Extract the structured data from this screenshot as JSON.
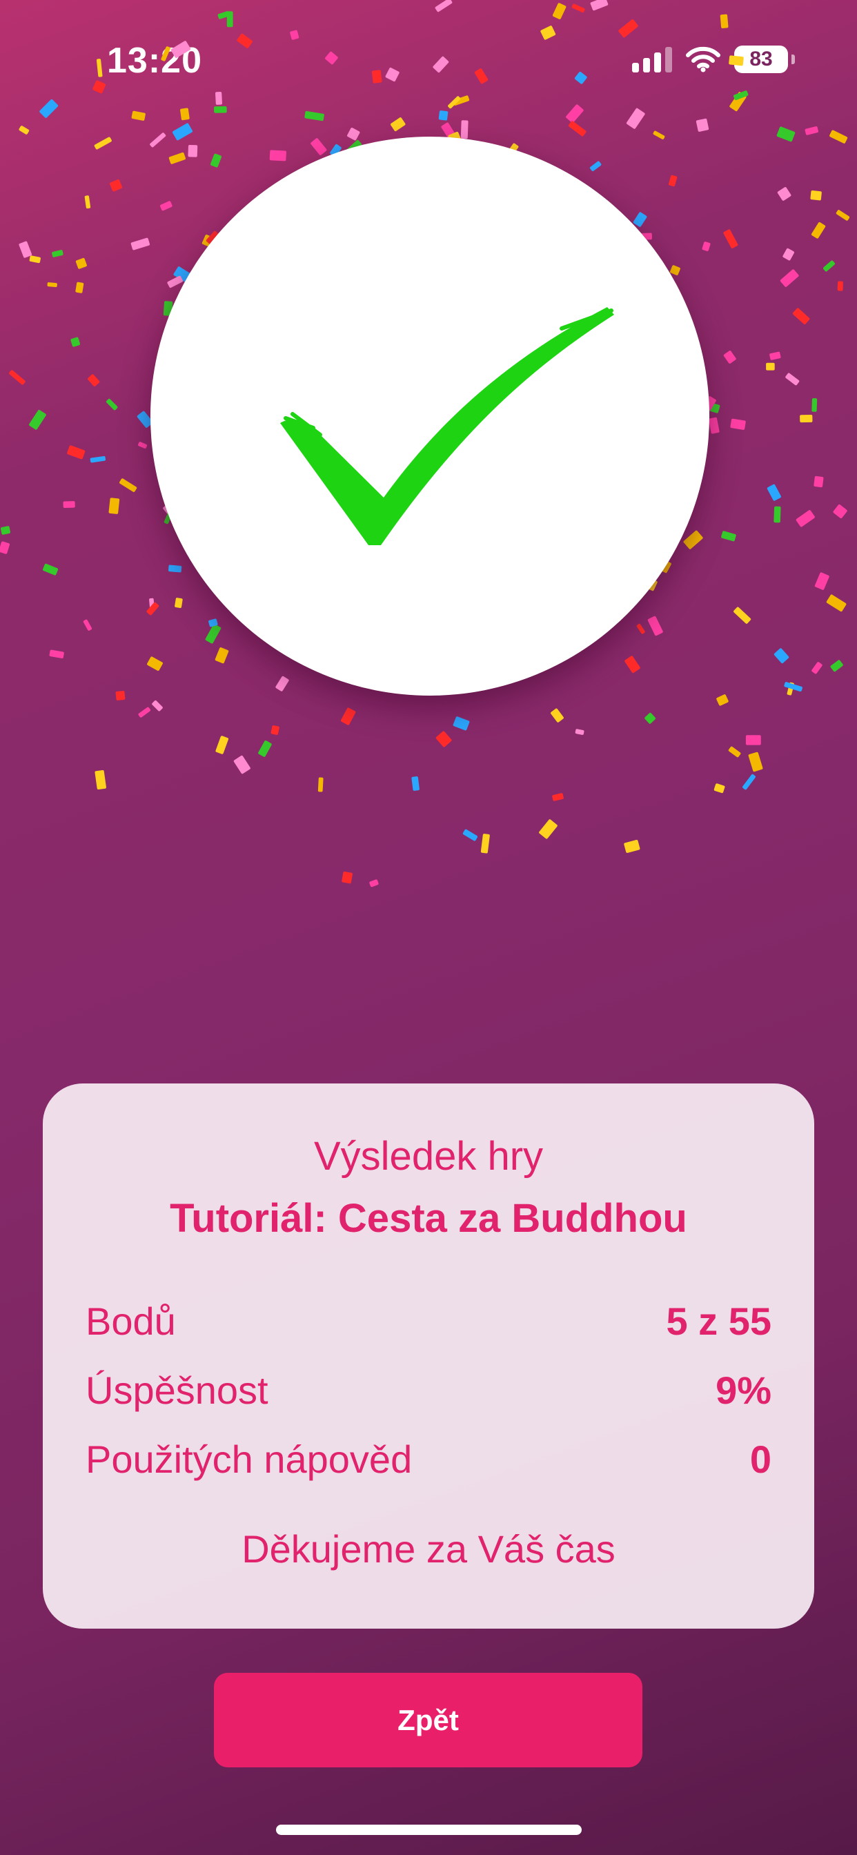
{
  "status_bar": {
    "time": "13:20",
    "battery": "83",
    "icons": [
      "cellular-signal-icon",
      "wifi-icon",
      "battery-icon"
    ]
  },
  "hero": {
    "icon": "check-mark-icon",
    "check_color": "#1ed312",
    "circle_color": "#ffffff"
  },
  "result_card": {
    "heading": "Výsledek hry",
    "title": "Tutoriál: Cesta za Buddhou",
    "stats": [
      {
        "label": "Bodů",
        "value": "5 z 55"
      },
      {
        "label": "Úspěšnost",
        "value": "9%"
      },
      {
        "label": "Použitých nápověd",
        "value": "0"
      }
    ],
    "thanks": "Děkujeme za Váš čas"
  },
  "actions": {
    "back_label": "Zpět"
  },
  "colors": {
    "accent": "#e0236c",
    "button": "#ea1f6a",
    "background_top": "#b8316f",
    "background_bottom": "#561a48"
  }
}
